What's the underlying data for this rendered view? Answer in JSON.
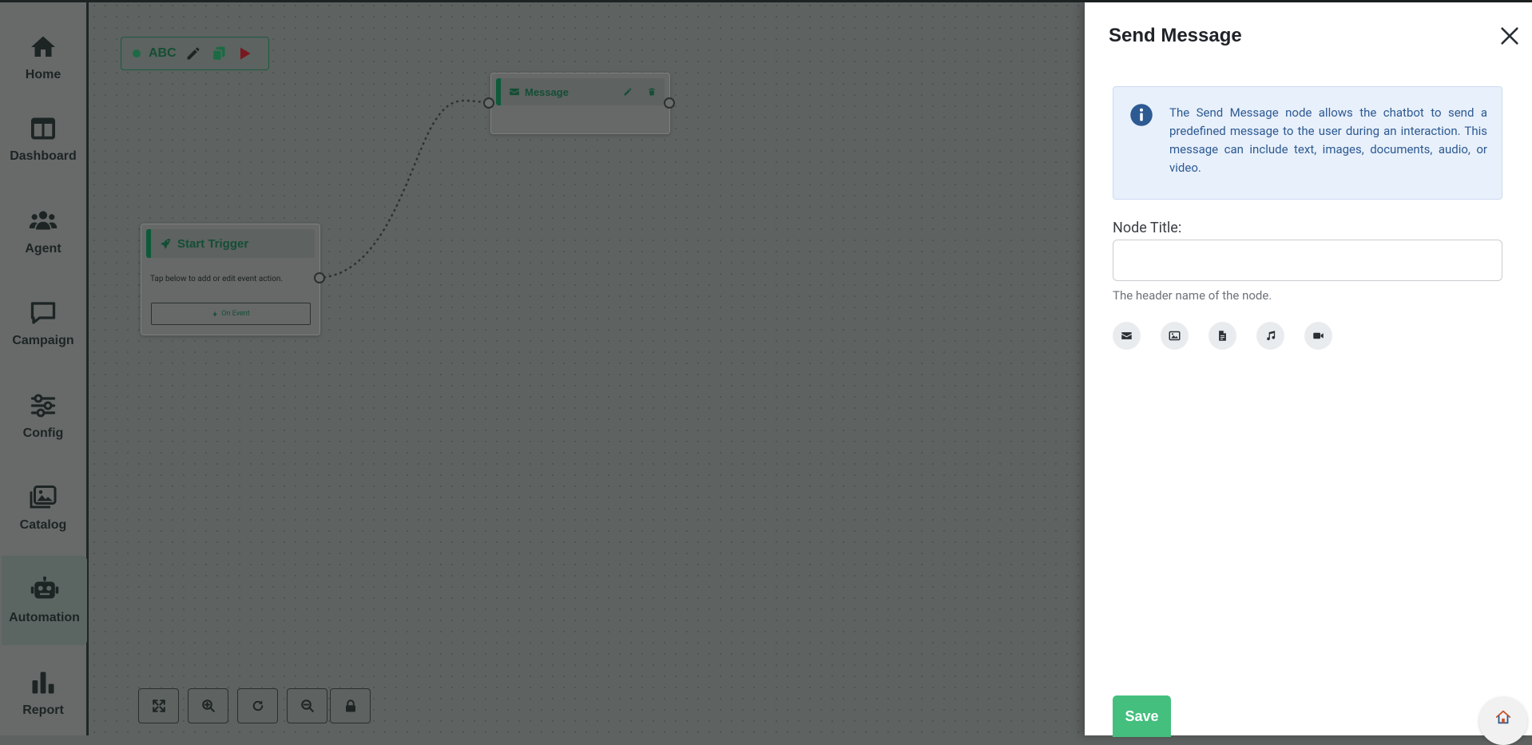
{
  "nav": {
    "items": [
      {
        "label": "Home",
        "icon": "home-icon"
      },
      {
        "label": "Dashboard",
        "icon": "dashboard-icon"
      },
      {
        "label": "Agent",
        "icon": "users-icon"
      },
      {
        "label": "Campaign",
        "icon": "chat-bubble-icon"
      },
      {
        "label": "Config",
        "icon": "sliders-icon"
      },
      {
        "label": "Catalog",
        "icon": "images-icon"
      },
      {
        "label": "Automation",
        "icon": "robot-icon",
        "active": true
      },
      {
        "label": "Report",
        "icon": "bar-chart-icon"
      }
    ]
  },
  "flow": {
    "name": "ABC",
    "nodes": {
      "message": {
        "title": "Message"
      },
      "start": {
        "title": "Start Trigger",
        "hint": "Tap below to add or edit event action.",
        "event_button": "On Event"
      }
    }
  },
  "panel": {
    "title": "Send Message",
    "info": "The Send Message node allows the chatbot to send a predefined message to the user during an interaction. This message can include text, images, documents, audio, or video.",
    "node_title_label": "Node Title:",
    "node_title_value": "",
    "node_title_help": "The header name of the node.",
    "message_types": [
      "envelope-icon",
      "image-icon",
      "document-icon",
      "music-icon",
      "video-icon"
    ],
    "save_label": "Save"
  },
  "colors": {
    "accent_green": "#44bf7d",
    "node_green": "#0e5a3a",
    "info_blue": "#2d5a92",
    "info_bg": "#e8f0fb"
  }
}
